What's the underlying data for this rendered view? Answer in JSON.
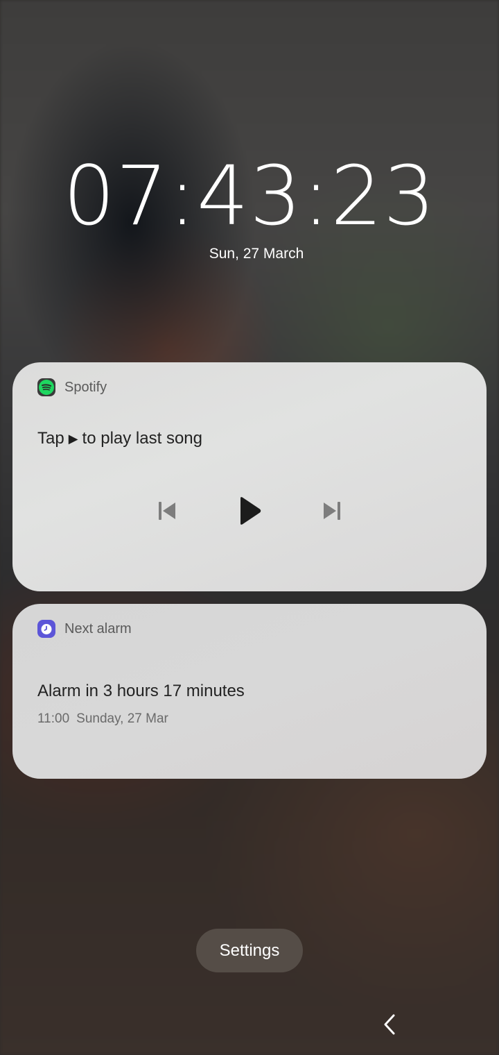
{
  "lockscreen": {
    "time": "07:43:23",
    "date": "Sun, 27 March"
  },
  "media_card": {
    "app_name": "Spotify",
    "app_icon": "spotify-icon",
    "prompt_before": "Tap",
    "prompt_glyph": "▶",
    "prompt_after": "to play last song",
    "controls": {
      "previous_icon": "skip-previous-icon",
      "play_icon": "play-icon",
      "next_icon": "skip-next-icon"
    }
  },
  "alarm_card": {
    "app_name": "Next alarm",
    "app_icon": "alarm-clock-icon",
    "title": "Alarm in 3 hours 17 minutes",
    "alarm_time": "11:00",
    "alarm_day": "Sunday, 27 Mar"
  },
  "settings_button": {
    "label": "Settings"
  },
  "navigation": {
    "back_icon": "back-chevron-icon"
  },
  "colors": {
    "spotify_green": "#1ed760",
    "alarm_accent": "#5c55d8",
    "card_background": "#dcdcdb",
    "settings_pill": "#58504a"
  }
}
